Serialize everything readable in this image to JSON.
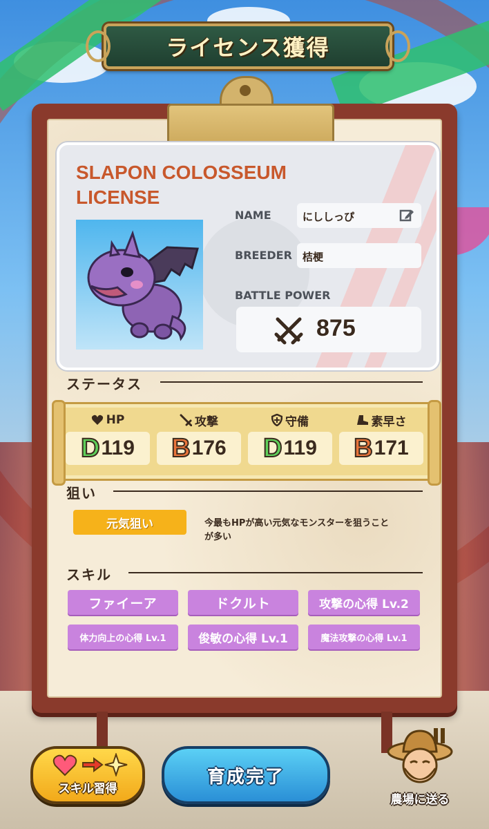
{
  "header": {
    "title": "ライセンス獲得"
  },
  "license": {
    "title_line1": "SLAPON COLOSSEUM",
    "title_line2": "LICENSE",
    "name_label": "NAME",
    "name_value": "にししっぴ",
    "breeder_label": "BREEDER",
    "breeder_value": "桔梗",
    "battle_power_label": "BATTLE POWER",
    "battle_power_value": "875",
    "monster_icon": "purple-dragon-portrait",
    "edit_icon": "pencil-edit-icon",
    "power_icon": "crossed-swords-icon"
  },
  "status": {
    "section_label": "ステータス",
    "stats": [
      {
        "icon": "heart-icon",
        "label": "HP",
        "grade": "D",
        "value": "119"
      },
      {
        "icon": "sword-icon",
        "label": "攻撃",
        "grade": "B",
        "value": "176"
      },
      {
        "icon": "shield-icon",
        "label": "守備",
        "grade": "D",
        "value": "119"
      },
      {
        "icon": "boot-icon",
        "label": "素早さ",
        "grade": "B",
        "value": "171"
      }
    ],
    "grade_colors": {
      "D": "#5fcf5a",
      "B": "#e8743a"
    }
  },
  "aim": {
    "section_label": "狙い",
    "tag": "元気狙い",
    "description_line1": "今最もHPが高い元気なモンスターを狙うこと",
    "description_line2": "が多い"
  },
  "skills": {
    "section_label": "スキル",
    "items": [
      "ファイーア",
      "ドクルト",
      "攻撃の心得 Lv.2",
      "体力向上の心得 Lv.1",
      "俊敏の心得 Lv.1",
      "魔法攻撃の心得 Lv.1"
    ]
  },
  "buttons": {
    "learn_skill": "スキル習得",
    "complete": "育成完了",
    "send_to_farm": "農場に送る"
  },
  "colors": {
    "board": "#8a3a2c",
    "paper": "#f6ecd8",
    "license_title": "#c8582c",
    "skill_tag": "#c983de",
    "aim_tag": "#f6b21a",
    "primary_button": "#2a8fd6",
    "secondary_button": "#f2a91a"
  }
}
